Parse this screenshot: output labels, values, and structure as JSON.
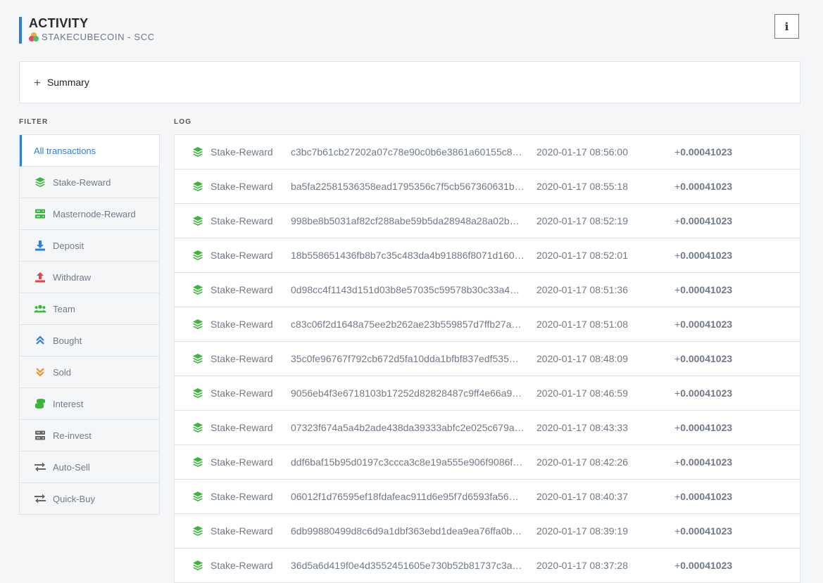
{
  "header": {
    "title": "ACTIVITY",
    "subtitle": "STAKECUBECOIN - SCC",
    "info_label": "i"
  },
  "summary": {
    "toggle": "+",
    "label": "Summary"
  },
  "filter": {
    "heading": "FILTER",
    "items": [
      {
        "label": "All transactions",
        "icon": "none",
        "active": true
      },
      {
        "label": "Stake-Reward",
        "icon": "stack-icon",
        "color": "#3cb53c"
      },
      {
        "label": "Masternode-Reward",
        "icon": "server-icon",
        "color": "#3cb53c"
      },
      {
        "label": "Deposit",
        "icon": "download-icon",
        "color": "#2f7fd8"
      },
      {
        "label": "Withdraw",
        "icon": "upload-icon",
        "color": "#e0454b"
      },
      {
        "label": "Team",
        "icon": "users-icon",
        "color": "#3cb53c"
      },
      {
        "label": "Bought",
        "icon": "chevrons-up-icon",
        "color": "#2f7fd8"
      },
      {
        "label": "Sold",
        "icon": "chevrons-down-icon",
        "color": "#f0932b"
      },
      {
        "label": "Interest",
        "icon": "coins-icon",
        "color": "#3cb53c"
      },
      {
        "label": "Re-invest",
        "icon": "server-icon",
        "color": "#666666"
      },
      {
        "label": "Auto-Sell",
        "icon": "exchange-icon",
        "color": "#666666"
      },
      {
        "label": "Quick-Buy",
        "icon": "exchange-icon",
        "color": "#666666"
      }
    ]
  },
  "log": {
    "heading": "LOG",
    "rows": [
      {
        "type": "Stake-Reward",
        "hash": "c3bc7b61cb27202a07c78e90c0b6e3861a60155c8…",
        "date": "2020-01-17 08:56:00",
        "sign": "+",
        "amount": "0.00041023"
      },
      {
        "type": "Stake-Reward",
        "hash": "ba5fa22581536358ead1795356c7f5cb567360631b…",
        "date": "2020-01-17 08:55:18",
        "sign": "+",
        "amount": "0.00041023"
      },
      {
        "type": "Stake-Reward",
        "hash": "998be8b5031af82cf288abe59b5da28948a28a02b3…",
        "date": "2020-01-17 08:52:19",
        "sign": "+",
        "amount": "0.00041023"
      },
      {
        "type": "Stake-Reward",
        "hash": "18b558651436fb8b7c35c483da4b91886f8071d160…",
        "date": "2020-01-17 08:52:01",
        "sign": "+",
        "amount": "0.00041023"
      },
      {
        "type": "Stake-Reward",
        "hash": "0d98cc4f1143d151d03b8e57035c59578b30c33a4…",
        "date": "2020-01-17 08:51:36",
        "sign": "+",
        "amount": "0.00041023"
      },
      {
        "type": "Stake-Reward",
        "hash": "c83c06f2d1648a75ee2b262ae23b559857d7ffb27a…",
        "date": "2020-01-17 08:51:08",
        "sign": "+",
        "amount": "0.00041023"
      },
      {
        "type": "Stake-Reward",
        "hash": "35c0fe96767f792cb672d5fa10dda1bfbf837edf535…",
        "date": "2020-01-17 08:48:09",
        "sign": "+",
        "amount": "0.00041023"
      },
      {
        "type": "Stake-Reward",
        "hash": "9056eb4f3e6718103b17252d82828487c9ff4e66a9…",
        "date": "2020-01-17 08:46:59",
        "sign": "+",
        "amount": "0.00041023"
      },
      {
        "type": "Stake-Reward",
        "hash": "07323f674a5a4b2ade438da39333abfc2e025c679a…",
        "date": "2020-01-17 08:43:33",
        "sign": "+",
        "amount": "0.00041023"
      },
      {
        "type": "Stake-Reward",
        "hash": "ddf6baf15b95d0197c3ccca3c8e19a555e906f9086f…",
        "date": "2020-01-17 08:42:26",
        "sign": "+",
        "amount": "0.00041023"
      },
      {
        "type": "Stake-Reward",
        "hash": "06012f1d76595ef18fdafeac911d6e95f7d6593fa56…",
        "date": "2020-01-17 08:40:37",
        "sign": "+",
        "amount": "0.00041023"
      },
      {
        "type": "Stake-Reward",
        "hash": "6db99880499d8c6d9a1dbf363ebd1dea9ea76ffa0b…",
        "date": "2020-01-17 08:39:19",
        "sign": "+",
        "amount": "0.00041023"
      },
      {
        "type": "Stake-Reward",
        "hash": "36d5a6d419f0e4d3552451605e730b52b81737c3a…",
        "date": "2020-01-17 08:37:28",
        "sign": "+",
        "amount": "0.00041023"
      }
    ]
  }
}
